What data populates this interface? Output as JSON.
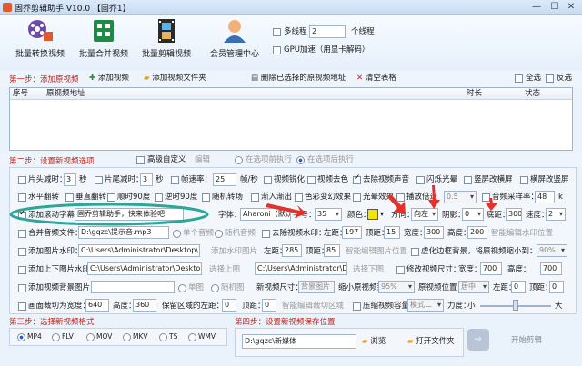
{
  "window": {
    "title": "固乔剪辑助手 V10.0 【固乔1】",
    "min": "—",
    "max": "☐",
    "close": "✕"
  },
  "toolbar": {
    "batch_convert": "批量转换视频",
    "batch_merge": "批量合并视频",
    "batch_edit": "批量剪辑视频",
    "member": "会员管理中心",
    "multithread_label": "多线程",
    "thread_count": "2",
    "thread_unit": "个线程",
    "gpu_label": "GPU加速（用显卡解码）"
  },
  "step1": {
    "title": "第一步：添加原视频",
    "add_video": "添加视频",
    "add_folder": "添加视频文件夹",
    "delete_selected": "删除已选择的原视频地址",
    "clear_table": "清空表格",
    "select_all": "全选",
    "invert": "反选"
  },
  "table": {
    "columns": [
      "序号",
      "原视频地址",
      "时长",
      "状态"
    ]
  },
  "step2": {
    "title": "第二步：设置新视频选项",
    "advanced": "高级自定义",
    "edit": "编辑",
    "before": "在选项前执行",
    "after": "在选项后执行"
  },
  "opts": {
    "r1": {
      "cut_start": "片头减时：",
      "cut_start_val": "3",
      "sec1": "秒",
      "cut_end": "片尾减时：",
      "cut_end_val": "3",
      "sec2": "秒",
      "fps": "帧速率：",
      "fps_val": "25",
      "fps_unit": "帧/秒",
      "optimize": "视频锐化",
      "color": "视频去色",
      "remove_audio": "去除视频声音",
      "flash": "闪烁光晕",
      "landscape": "竖屏改横屏",
      "portrait": "横屏改竖屏"
    },
    "r2": {
      "hflip": "水平翻转",
      "vflip": "垂直翻转",
      "rot90": "顺时90度",
      "crot90": "逆时90度",
      "random_transition": "随机转场",
      "fade": "渐入渐出",
      "blur": "色彩变幻效果",
      "light": "光晕效果",
      "speed": "播放倍速",
      "speed_val": "0.5",
      "sample": "音频采样率：",
      "sample_val": "48",
      "sample_unit": "k"
    },
    "r3": {
      "add_subtitle": "添加滚动字幕：",
      "subtitle_text": "固乔剪辑助手，快来体验吧",
      "font": "字体：",
      "font_val": "Aharoni（默认）",
      "size": "字号：",
      "size_val": "35",
      "color": "颜色：",
      "dir": "方向：",
      "dir_val": "向左",
      "shadow": "阴影：",
      "shadow_val": "0",
      "bottom": "底距：",
      "bottom_val": "300",
      "speed": "速度：",
      "speed_val": "2"
    },
    "r4": {
      "merge_audio": "合并音频文件：",
      "audio_path": "D:\\gqzc\\提示音.mp3",
      "single_audio": "单个音频",
      "random_audio": "随机音频",
      "remove_watermark": "去除视频水印：",
      "left": "左距：",
      "left_val": "197",
      "top": "顶距：",
      "top_val": "15",
      "width": "宽度：",
      "width_val": "300",
      "height": "高度：",
      "height_val": "200",
      "smart_wm": "智能编辑水印位置"
    },
    "r5": {
      "add_image_wm": "添加图片水印：",
      "image_path": "C:\\Users\\Administrator\\Desktop\\111.jpg",
      "add_wm_image": "添加水印图片",
      "left": "左距：",
      "left_val": "285",
      "top": "顶距：",
      "top_val": "85",
      "smart_img": "智能编辑图片位置",
      "virtual_bg": "虚化边框背景，将原视频缩小到：",
      "virtual_val": "90%"
    },
    "r6": {
      "add_frame": "添加上下图片水印：",
      "frame_path": "C:\\Users\\Administrator\\Desktop\\top.png",
      "top_img": "选择上图",
      "frame_path2": "C:\\Users\\Administrator\\Desktop\\bot.png",
      "bottom_img": "选择下图",
      "resize": "修改视频尺寸：",
      "width": "宽度：",
      "width_val": "700",
      "height": "高度：",
      "height_val": "700"
    },
    "r7": {
      "add_bg": "添加视频背景图片：",
      "single": "单图",
      "random": "随机图",
      "new_size": "新视频尺寸：",
      "bg_label": "背景图片",
      "shrink": "缩小原视频到：",
      "shrink_val": "95%",
      "pos": "原视频位置：",
      "pos_val": "居中",
      "left": "左距：",
      "left_val": "0",
      "top": "顶距：",
      "top_val": "0"
    },
    "r8": {
      "crop": "画面裁切为宽度：",
      "crop_w": "640",
      "height": "高度：",
      "crop_h": "360",
      "keep": "保留区域的左距：",
      "keep_val": "0",
      "top": "顶距：",
      "top_val": "0",
      "smart_crop": "智能编辑裁切区域",
      "compress": "压缩视频容量",
      "mode_val": "模式二",
      "strength": "力度：",
      "small": "小",
      "large": "大"
    }
  },
  "step3": {
    "title": "第三步：选择新视频格式",
    "formats": [
      "MP4",
      "FLV",
      "MOV",
      "MKV",
      "TS",
      "WMV"
    ]
  },
  "step4": {
    "title": "第四步：设置新视频保存位置",
    "path": "D:\\gqzc\\新媒体",
    "browse": "浏览",
    "open_folder": "打开文件夹"
  },
  "start": {
    "label": "开始剪辑"
  },
  "colors": {
    "accent": "#2b63b5",
    "step_red": "#c0241b",
    "arrow_red": "#e8302a",
    "highlight_teal": "#2aa69b"
  }
}
